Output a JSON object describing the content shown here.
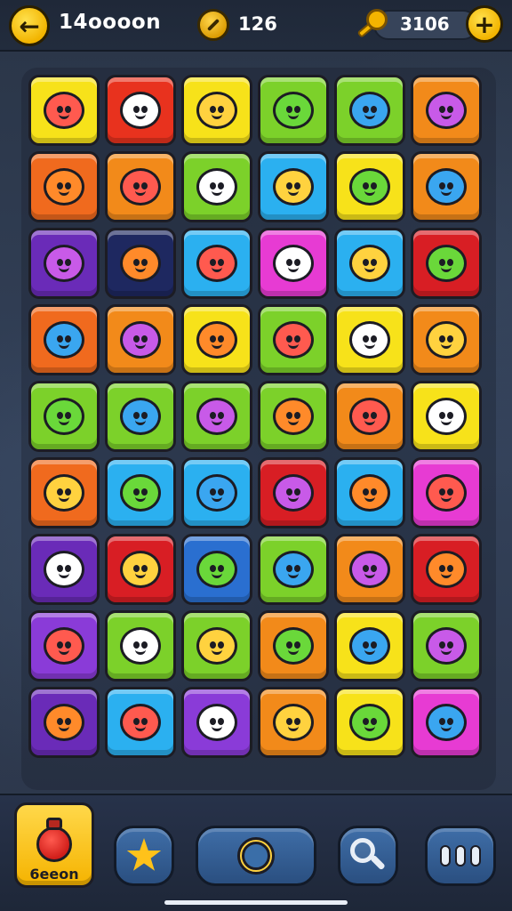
{
  "header": {
    "level_title": "14oooon",
    "coins": "126",
    "gems": "3106"
  },
  "board": {
    "rows": [
      [
        {
          "color": "#f7e21a",
          "icon": "red-bear-icon"
        },
        {
          "color": "#e8321e",
          "icon": "white-cat-icon"
        },
        {
          "color": "#f7e21a",
          "icon": "heart-card-icon"
        },
        {
          "color": "#7cd12a",
          "icon": "leaf-icon"
        },
        {
          "color": "#7cd12a",
          "icon": "sun-face-icon"
        },
        {
          "color": "#f28a1a",
          "icon": "boy-face-icon"
        }
      ],
      [
        {
          "color": "#f06a1e",
          "icon": "red-fox-icon"
        },
        {
          "color": "#f28a1a",
          "icon": "red-dragon-icon"
        },
        {
          "color": "#7cd12a",
          "icon": "white-ghost-icon"
        },
        {
          "color": "#2bb0f0",
          "icon": "yellow-smile-icon"
        },
        {
          "color": "#f7e21a",
          "icon": "blue-fish-icon"
        },
        {
          "color": "#f28a1a",
          "icon": "green-pear-icon"
        }
      ],
      [
        {
          "color": "#6a2bb8",
          "icon": "lightning-cloud-icon"
        },
        {
          "color": "#1e2860",
          "icon": "chef-hat-icon"
        },
        {
          "color": "#2bb0f0",
          "icon": "pink-radish-icon"
        },
        {
          "color": "#e73bd3",
          "icon": "green-blob-icon"
        },
        {
          "color": "#2bb0f0",
          "icon": "blue-crystal-icon"
        },
        {
          "color": "#d81e24",
          "icon": "purple-cat-icon"
        }
      ],
      [
        {
          "color": "#f06a1e",
          "icon": "red-tomato-icon"
        },
        {
          "color": "#f28a1a",
          "icon": "pink-berry-icon"
        },
        {
          "color": "#f7e21a",
          "icon": "red-apple-icon"
        },
        {
          "color": "#7cd12a",
          "icon": "green-leaf-icon"
        },
        {
          "color": "#f7e21a",
          "icon": "yellow-lemon-icon"
        },
        {
          "color": "#f28a1a",
          "icon": "red-flower-icon"
        }
      ],
      [
        {
          "color": "#7cd12a",
          "icon": "pink-turnip-icon"
        },
        {
          "color": "#7cd12a",
          "icon": "orange-fruit-icon"
        },
        {
          "color": "#7cd12a",
          "icon": "flame-face-icon"
        },
        {
          "color": "#7cd12a",
          "icon": "yellow-face-icon"
        },
        {
          "color": "#f28a1a",
          "icon": "skull-critter-icon"
        },
        {
          "color": "#f7e21a",
          "icon": "green-frog-icon"
        }
      ],
      [
        {
          "color": "#f06a1e",
          "icon": "brush-shield-icon"
        },
        {
          "color": "#2bb0f0",
          "icon": "purple-eggplant-icon"
        },
        {
          "color": "#2bb0f0",
          "icon": "red-balloon-icon"
        },
        {
          "color": "#d81e24",
          "icon": "pink-onion-icon"
        },
        {
          "color": "#2bb0f0",
          "icon": "green-cactus-icon"
        },
        {
          "color": "#e73bd3",
          "icon": "green-slime-icon"
        }
      ],
      [
        {
          "color": "#6a2bb8",
          "icon": "green-monster-icon"
        },
        {
          "color": "#d81e24",
          "icon": "yellow-chick-icon"
        },
        {
          "color": "#2a6fd0",
          "icon": "orange-cat-icon"
        },
        {
          "color": "#7cd12a",
          "icon": "green-dino-icon"
        },
        {
          "color": "#f28a1a",
          "icon": "wooden-crate-icon"
        },
        {
          "color": "#d81e24",
          "icon": "black-bomb-icon"
        }
      ],
      [
        {
          "color": "#8a3bd8",
          "icon": "blue-cat-icon"
        },
        {
          "color": "#7cd12a",
          "icon": "purple-virus-icon"
        },
        {
          "color": "#7cd12a",
          "icon": "orange-drop-icon"
        },
        {
          "color": "#f28a1a",
          "icon": "pink-gear-icon"
        },
        {
          "color": "#f7e21a",
          "icon": "blue-slime-icon"
        },
        {
          "color": "#7cd12a",
          "icon": "orange-fruit-icon"
        }
      ],
      [
        {
          "color": "#6a2bb8",
          "icon": "gold-shuriken-icon"
        },
        {
          "color": "#2bb0f0",
          "icon": "green-sprout-icon"
        },
        {
          "color": "#8a3bd8",
          "icon": "orange-crab-icon"
        },
        {
          "color": "#f28a1a",
          "icon": "pink-puff-icon"
        },
        {
          "color": "#f7e21a",
          "icon": "yellow-owl-icon"
        },
        {
          "color": "#e73bd3",
          "icon": "purple-drop-icon"
        }
      ]
    ]
  },
  "footer": {
    "booster_label": "6eeon"
  }
}
